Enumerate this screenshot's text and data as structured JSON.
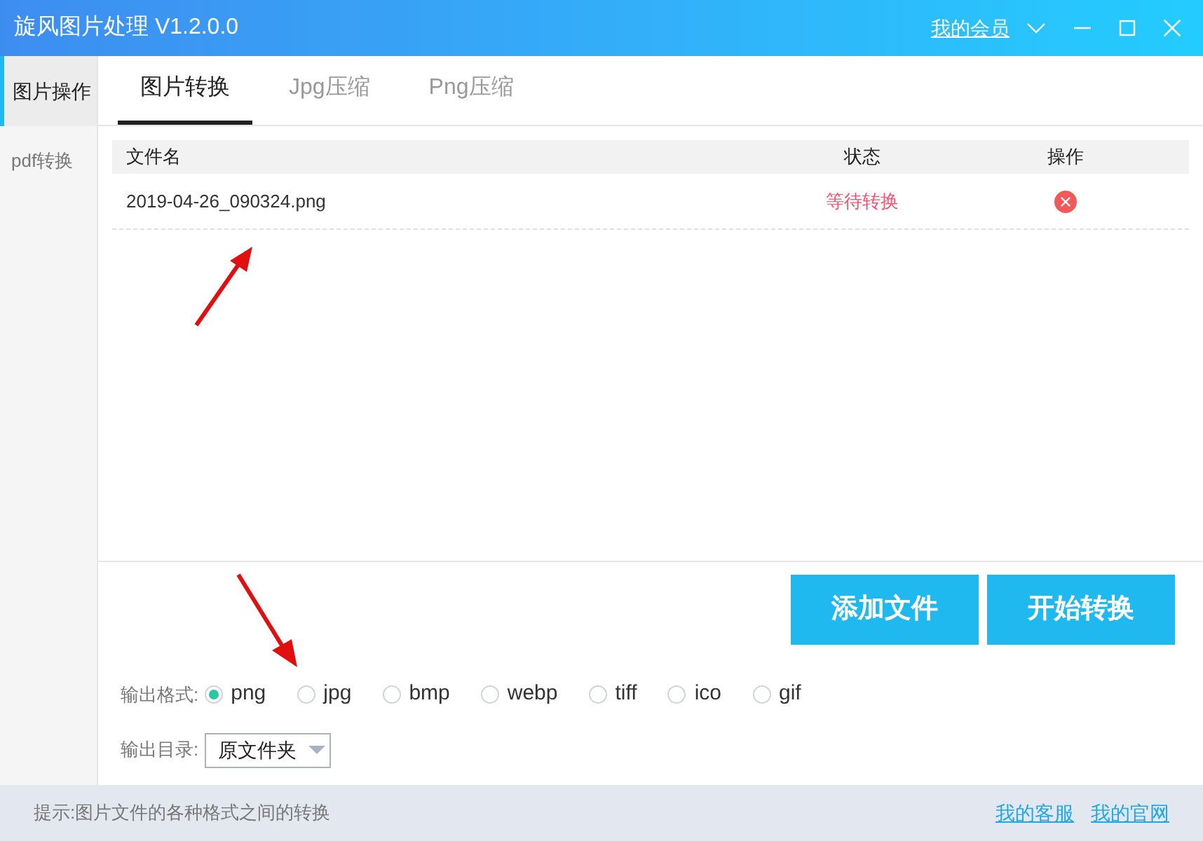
{
  "window": {
    "title": "旋风图片处理 V1.2.0.0",
    "member_link": "我的会员"
  },
  "sidebar": {
    "items": [
      {
        "label": "图片操作",
        "selected": true
      },
      {
        "label": "pdf转换",
        "selected": false
      }
    ]
  },
  "tabs": [
    {
      "label": "图片转换",
      "selected": true
    },
    {
      "label": "Jpg压缩",
      "selected": false
    },
    {
      "label": "Png压缩",
      "selected": false
    }
  ],
  "table": {
    "columns": [
      "文件名",
      "状态",
      "操作"
    ],
    "rows": [
      {
        "file": "2019-04-26_090324.png",
        "status": "等待转换"
      }
    ]
  },
  "buttons": [
    "添加文件",
    "开始转换"
  ],
  "output_format": {
    "label": "输出格式:",
    "options": [
      {
        "label": "png",
        "selected": true
      },
      {
        "label": "jpg",
        "selected": false
      },
      {
        "label": "bmp",
        "selected": false
      },
      {
        "label": "webp",
        "selected": false
      },
      {
        "label": "tiff",
        "selected": false
      },
      {
        "label": "ico",
        "selected": false
      },
      {
        "label": "gif",
        "selected": false
      }
    ]
  },
  "output_dir": {
    "label": "输出目录:",
    "value": "原文件夹"
  },
  "status_bar": {
    "hint": "提示:图片文件的各种格式之间的转换",
    "links": [
      "我的客服",
      "我的官网"
    ]
  }
}
